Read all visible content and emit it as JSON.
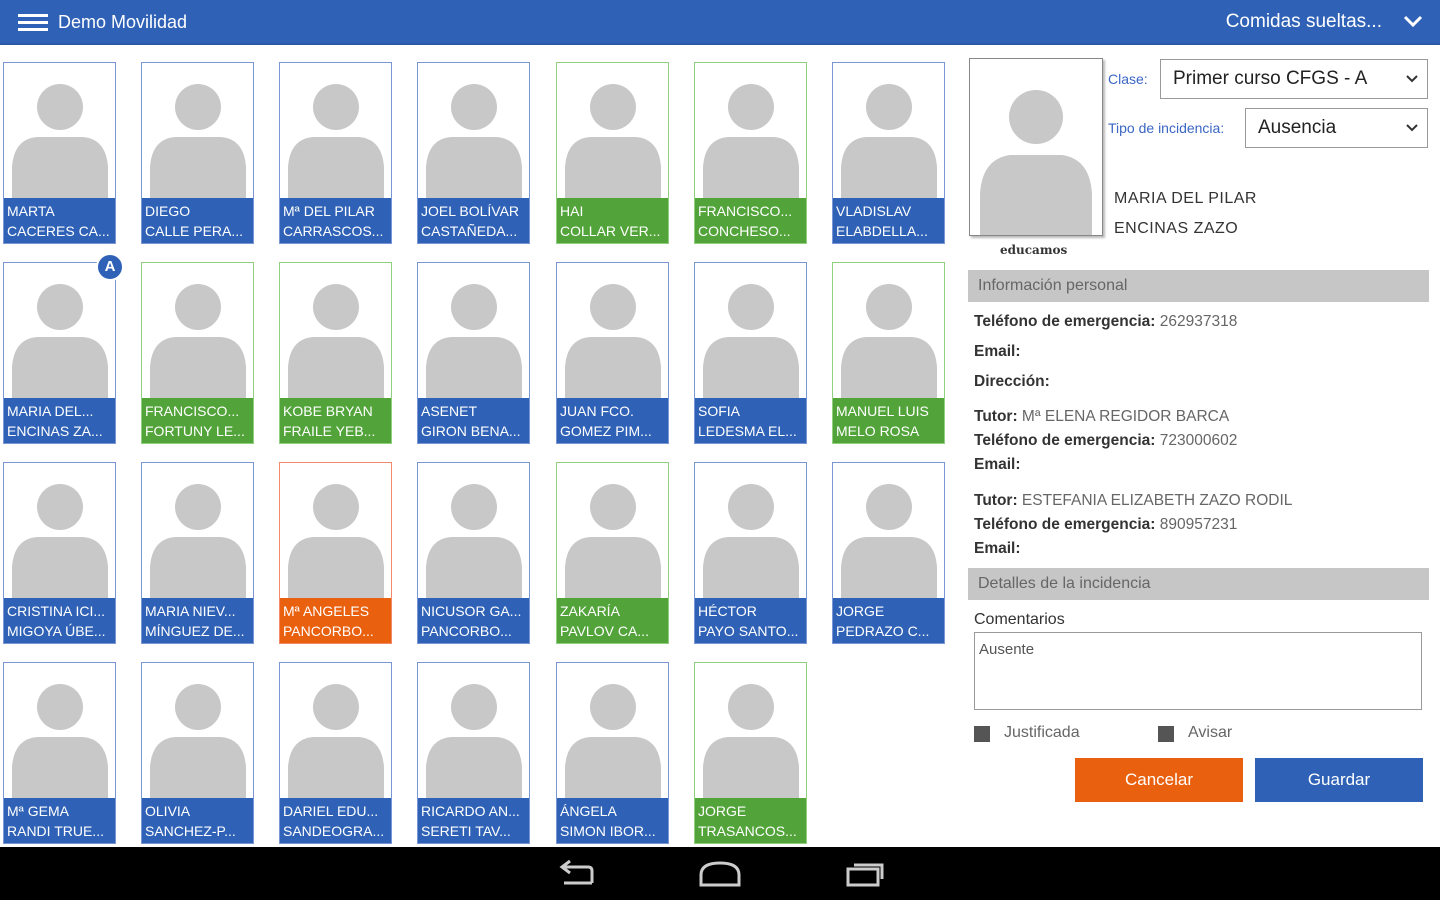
{
  "header": {
    "app_title": "Demo Movilidad",
    "menu_title": "Comidas sueltas...",
    "icons": [
      "menu-icon",
      "chevron-down-icon"
    ]
  },
  "colors": {
    "primary": "#2f62b6",
    "green": "#52a43a",
    "orange": "#e9600e",
    "avatar_gray": "#c8c8c8"
  },
  "students": [
    {
      "line1": "MARTA",
      "line2": "CACERES CA...",
      "status": "blue"
    },
    {
      "line1": "DIEGO",
      "line2": "CALLE PERA...",
      "status": "blue"
    },
    {
      "line1": "Mª DEL PILAR",
      "line2": "CARRASCOS...",
      "status": "blue"
    },
    {
      "line1": "JOEL BOLÍVAR",
      "line2": "CASTAÑEDA...",
      "status": "blue"
    },
    {
      "line1": "HAI",
      "line2": "COLLAR VER...",
      "status": "green"
    },
    {
      "line1": "FRANCISCO...",
      "line2": "CONCHESO...",
      "status": "green"
    },
    {
      "line1": "VLADISLAV",
      "line2": "ELABDELLA...",
      "status": "blue"
    },
    {
      "line1": "MARIA DEL...",
      "line2": "ENCINAS ZA...",
      "status": "blue"
    },
    {
      "line1": "FRANCISCO...",
      "line2": "FORTUNY LE...",
      "status": "green"
    },
    {
      "line1": "KOBE BRYAN",
      "line2": "FRAILE YEB...",
      "status": "green"
    },
    {
      "line1": "ASENET",
      "line2": "GIRON BENA...",
      "status": "blue"
    },
    {
      "line1": "JUAN FCO.",
      "line2": "GOMEZ PIM...",
      "status": "blue"
    },
    {
      "line1": "SOFIA",
      "line2": "LEDESMA EL...",
      "status": "blue"
    },
    {
      "line1": "MANUEL LUIS",
      "line2": "MELO ROSA",
      "status": "green"
    },
    {
      "line1": "CRISTINA ICI...",
      "line2": "MIGOYA ÚBE...",
      "status": "blue"
    },
    {
      "line1": "MARIA NIEV...",
      "line2": "MÍNGUEZ DE...",
      "status": "blue"
    },
    {
      "line1": "Mª ANGELES",
      "line2": "PANCORBO...",
      "status": "orange"
    },
    {
      "line1": "NICUSOR GA...",
      "line2": "PANCORBO...",
      "status": "blue"
    },
    {
      "line1": "ZAKARÍA",
      "line2": "PAVLOV CA...",
      "status": "green"
    },
    {
      "line1": "HÉCTOR",
      "line2": "PAYO SANTO...",
      "status": "blue"
    },
    {
      "line1": "JORGE",
      "line2": "PEDRAZO C...",
      "status": "blue"
    },
    {
      "line1": "Mª GEMA",
      "line2": "RANDI TRUE...",
      "status": "blue"
    },
    {
      "line1": "OLIVIA",
      "line2": "SANCHEZ-P...",
      "status": "blue"
    },
    {
      "line1": "DARIEL EDU...",
      "line2": "SANDEOGRA...",
      "status": "blue"
    },
    {
      "line1": "RICARDO AN...",
      "line2": "SERETI TAV...",
      "status": "blue"
    },
    {
      "line1": "ÁNGELA",
      "line2": "SIMON IBOR...",
      "status": "blue"
    },
    {
      "line1": "JORGE",
      "line2": "TRASANCOS...",
      "status": "green"
    }
  ],
  "badge": {
    "text": "A"
  },
  "panel": {
    "photo_caption": "educamos",
    "class_label": "Clase:",
    "class_value": "Primer curso CFGS - A",
    "incident_label": "Tipo de incidencia:",
    "incident_value": "Ausencia",
    "student_name_line1": "MARIA DEL PILAR",
    "student_name_line2": "ENCINAS ZAZO",
    "section_personal": "Información personal",
    "emergency_label": "Teléfono de emergencia:",
    "emergency_value": "262937318",
    "email_label": "Email:",
    "address_label": "Dirección:",
    "tutor_label": "Tutor:",
    "tutor1_name": "Mª ELENA REGIDOR BARCA",
    "tutor1_phone": "723000602",
    "tutor2_name": "ESTEFANIA ELIZABETH ZAZO RODIL",
    "tutor2_phone": "890957231",
    "section_incident": "Detalles de la incidencia",
    "comments_label": "Comentarios",
    "comments_value": "Ausente",
    "justified_label": "Justificada",
    "notify_label": "Avisar",
    "cancel_label": "Cancelar",
    "save_label": "Guardar"
  },
  "nav_icons": [
    "back-icon",
    "home-icon",
    "recent-apps-icon"
  ]
}
